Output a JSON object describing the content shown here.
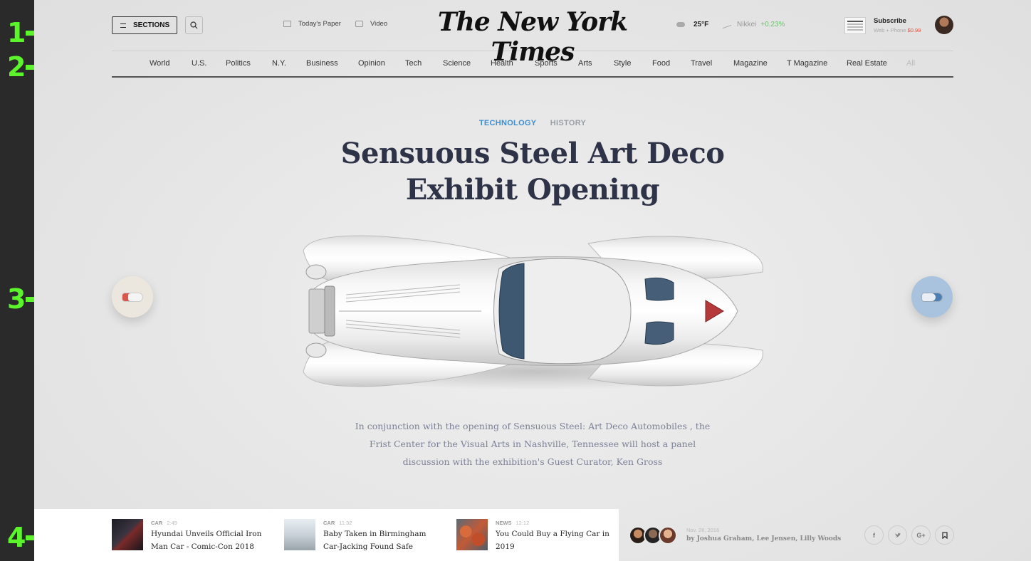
{
  "annotations": [
    "1",
    "2",
    "3",
    "4"
  ],
  "header": {
    "sections_label": "SECTIONS",
    "search_icon": "search-icon",
    "todays_paper": "Today's Paper",
    "video": "Video",
    "logo": "The New York Times",
    "weather": "25°F",
    "market_name": "Nikkei",
    "market_change": "+0.23%",
    "subscribe_title": "Subscribe",
    "subscribe_sub": "Web + Phone",
    "subscribe_price": "$0.99"
  },
  "nav": {
    "items": [
      "World",
      "U.S.",
      "Politics",
      "N.Y.",
      "Business",
      "Opinion",
      "Tech",
      "Science",
      "Health",
      "Sports",
      "Arts",
      "Style",
      "Food",
      "Travel",
      "Magazine",
      "T Magazine",
      "Real Estate",
      "All"
    ]
  },
  "hero": {
    "tag_primary": "TECHNOLOGY",
    "tag_secondary": "HISTORY",
    "headline": "Sensuous Steel Art Deco Exhibit Opening",
    "body": "In conjunction with the opening of Sensuous Steel: Art Deco Automobiles , the Frist Center for the Visual Arts in Nashville, Tennessee will host a panel discussion with the exhibition's Guest Curator, Ken Gross"
  },
  "related": [
    {
      "category": "CAR",
      "time": "2:49",
      "title": "Hyundai Unveils Official Iron Man Car - Comic-Con 2018"
    },
    {
      "category": "CAR",
      "time": "11:32",
      "title": "Baby Taken in Birmingham Car-Jacking Found Safe"
    },
    {
      "category": "NEWS",
      "time": "12:12",
      "title": "You Could Buy a Flying Car in 2019"
    }
  ],
  "byline": {
    "date": "Nov. 28, 2016",
    "authors": "by Joshua Graham, Lee Jensen, Lilly Woods"
  },
  "social": {
    "facebook": "f",
    "google": "G+"
  },
  "colors": {
    "accent_tag": "#3d8fd1",
    "market_up": "#6fc36f",
    "price": "#e2513d",
    "annotation": "#5cf52c"
  }
}
